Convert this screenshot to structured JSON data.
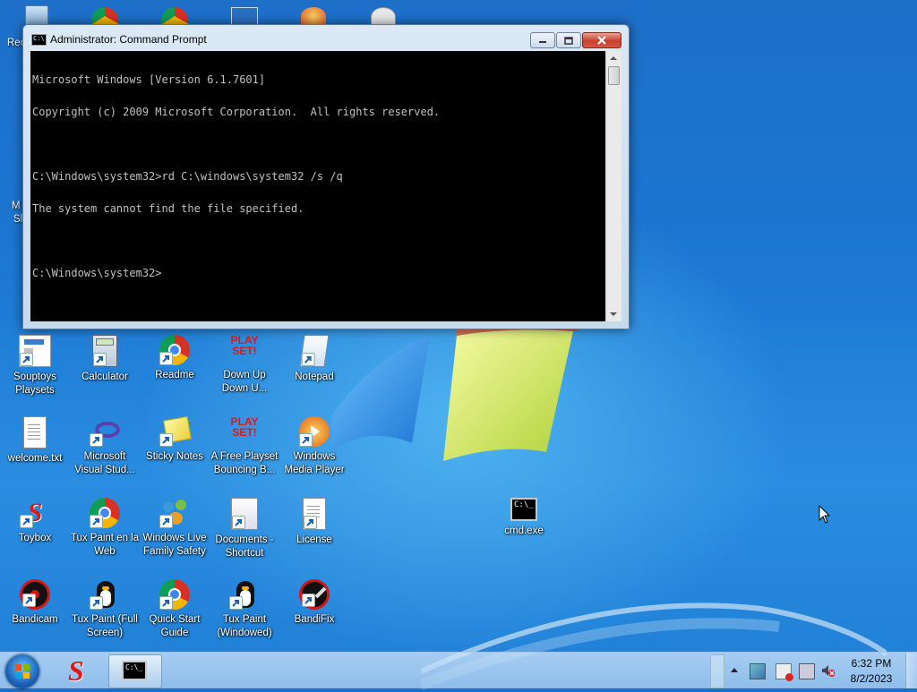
{
  "console_window": {
    "title": "Administrator: Command Prompt",
    "icon": "cmd-icon",
    "lines": [
      "Microsoft Windows [Version 6.1.7601]",
      "Copyright (c) 2009 Microsoft Corporation.  All rights reserved.",
      "",
      "C:\\Windows\\system32>rd C:\\windows\\system32 /s /q",
      "The system cannot find the file specified.",
      "",
      "C:\\Windows\\system32>"
    ]
  },
  "desktop_icons": {
    "top_partial_label": "Rec",
    "left_partial_1": "M",
    "left_partial_2": "Sl",
    "row1": [
      {
        "label": "Souptoys Playsets",
        "icon": "souptoys-icon"
      },
      {
        "label": "Calculator",
        "icon": "calculator-icon"
      },
      {
        "label": "Readme",
        "icon": "chrome-icon"
      },
      {
        "label": "Down Up Down U...",
        "icon": "playset-icon"
      },
      {
        "label": "Notepad",
        "icon": "notepad-icon"
      }
    ],
    "row2": [
      {
        "label": "welcome.txt",
        "icon": "text-file-icon"
      },
      {
        "label": "Microsoft Visual Stud...",
        "icon": "visual-studio-icon"
      },
      {
        "label": "Sticky Notes",
        "icon": "sticky-notes-icon"
      },
      {
        "label": "A Free Playset Bouncing B...",
        "icon": "playset-icon"
      },
      {
        "label": "Windows Media Player",
        "icon": "media-player-icon"
      }
    ],
    "row3": [
      {
        "label": "Toybox",
        "icon": "toybox-icon"
      },
      {
        "label": "Tux Paint en la Web",
        "icon": "chrome-icon"
      },
      {
        "label": "Windows Live Family Safety",
        "icon": "family-safety-icon"
      },
      {
        "label": "Documents - Shortcut",
        "icon": "documents-icon"
      },
      {
        "label": "License",
        "icon": "document-icon"
      },
      {
        "label": "cmd.exe",
        "icon": "cmd-icon"
      }
    ],
    "row4": [
      {
        "label": "Bandicam",
        "icon": "bandicam-icon"
      },
      {
        "label": "Tux Paint (Full Screen)",
        "icon": "tux-icon"
      },
      {
        "label": "Quick Start Guide",
        "icon": "chrome-icon"
      },
      {
        "label": "Tux Paint (Windowed)",
        "icon": "tux-icon"
      },
      {
        "label": "BandiFix",
        "icon": "bandifix-icon"
      }
    ]
  },
  "taskbar": {
    "time": "6:32 PM",
    "date": "8/2/2023",
    "pinned": [
      "toybox-icon",
      "cmd-icon"
    ],
    "tray_icons": [
      "show-hidden-icons-icon",
      "action-center-icon",
      "network-icon",
      "volume-muted-icon"
    ]
  }
}
